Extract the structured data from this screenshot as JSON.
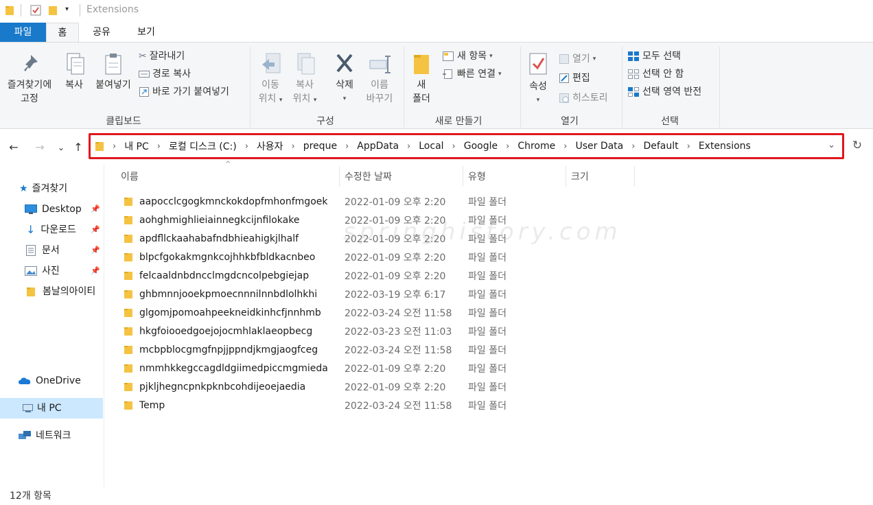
{
  "window": {
    "title": "Extensions"
  },
  "ribbon_tabs": [
    "파일",
    "홈",
    "공유",
    "보기"
  ],
  "clipboard": {
    "pin_label_1": "즐겨찾기에",
    "pin_label_2": "고정",
    "copy_label": "복사",
    "paste_label": "붙여넣기",
    "cut_label": "잘라내기",
    "copy_path_label": "경로 복사",
    "paste_shortcut_label": "바로 가기 붙여넣기",
    "group_label": "클립보드"
  },
  "organize": {
    "move_to_1": "이동",
    "move_to_2": "위치",
    "copy_to_1": "복사",
    "copy_to_2": "위치",
    "delete_label": "삭제",
    "rename_1": "이름",
    "rename_2": "바꾸기",
    "group_label": "구성"
  },
  "new": {
    "new_folder_1": "새",
    "new_folder_2": "폴더",
    "new_item_label": "새 항목",
    "easy_access_label": "빠른 연결",
    "group_label": "새로 만들기"
  },
  "open": {
    "properties_label": "속성",
    "open_label": "열기",
    "edit_label": "편집",
    "history_label": "히스토리",
    "group_label": "열기"
  },
  "select": {
    "select_all_label": "모두 선택",
    "select_none_label": "선택 안 함",
    "invert_label": "선택 영역 반전",
    "group_label": "선택"
  },
  "breadcrumb": [
    "내 PC",
    "로컬 디스크 (C:)",
    "사용자",
    "preque",
    "AppData",
    "Local",
    "Google",
    "Chrome",
    "User Data",
    "Default",
    "Extensions"
  ],
  "sidebar": {
    "quick_access": "즐겨찾기",
    "desktop": "Desktop",
    "downloads": "다운로드",
    "documents": "문서",
    "pictures": "사진",
    "folder_bom": "봄날의아이티",
    "onedrive": "OneDrive",
    "this_pc": "내 PC",
    "network": "네트워크"
  },
  "columns": {
    "name": "이름",
    "date": "수정한 날짜",
    "type": "유형",
    "size": "크기"
  },
  "files": [
    {
      "name": "aapocclcgogkmnckokdopfmhonfmgoek",
      "date": "2022-01-09 오후 2:20",
      "type": "파일 폴더"
    },
    {
      "name": "aohghmighlieiainnegkcijnfilokake",
      "date": "2022-01-09 오후 2:20",
      "type": "파일 폴더"
    },
    {
      "name": "apdfllckaahabafndbhieahigkjlhalf",
      "date": "2022-01-09 오후 2:20",
      "type": "파일 폴더"
    },
    {
      "name": "blpcfgokakmgnkcojhhkbfbldkacnbeo",
      "date": "2022-01-09 오후 2:20",
      "type": "파일 폴더"
    },
    {
      "name": "felcaaldnbdncclmgdcncolpebgiejap",
      "date": "2022-01-09 오후 2:20",
      "type": "파일 폴더"
    },
    {
      "name": "ghbmnnjooekpmoecnnnilnnbdlolhkhi",
      "date": "2022-03-19 오후 6:17",
      "type": "파일 폴더"
    },
    {
      "name": "glgomjpomoahpeekneidkinhcfjnnhmb",
      "date": "2022-03-24 오전 11:58",
      "type": "파일 폴더"
    },
    {
      "name": "hkgfoiooedgoejojocmhlaklaeopbecg",
      "date": "2022-03-23 오전 11:03",
      "type": "파일 폴더"
    },
    {
      "name": "mcbpblocgmgfnpjjppndjkmgjaogfceg",
      "date": "2022-03-24 오전 11:58",
      "type": "파일 폴더"
    },
    {
      "name": "nmmhkkegccagdldgiimedpiccmgmieda",
      "date": "2022-01-09 오후 2:20",
      "type": "파일 폴더"
    },
    {
      "name": "pjkljhegncpnkpknbcohdijeoejaedia",
      "date": "2022-01-09 오후 2:20",
      "type": "파일 폴더"
    },
    {
      "name": "Temp",
      "date": "2022-03-24 오전 11:58",
      "type": "파일 폴더"
    }
  ],
  "status": {
    "item_count": "12개 항목"
  },
  "watermark": "springhistory.com",
  "colors": {
    "accent": "#1979ca",
    "highlight_border": "#e0161d",
    "selected_bg": "#cce8ff",
    "folder": "#f5c342"
  }
}
